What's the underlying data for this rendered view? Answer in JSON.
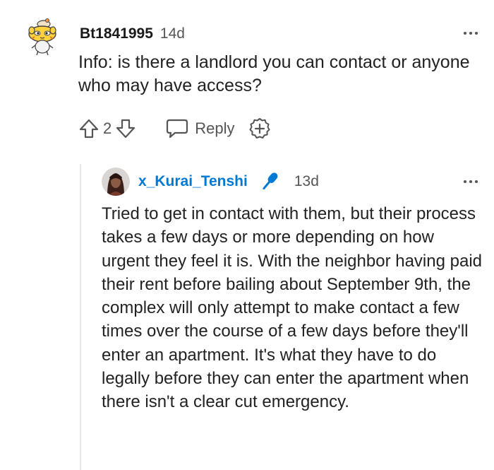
{
  "comment": {
    "username": "Bt1841995",
    "age": "14d",
    "body": "Info: is there a landlord you can contact or anyone who may have access?",
    "vote_count": "2",
    "reply_label": "Reply"
  },
  "reply": {
    "username": "x_Kurai_Tenshi",
    "age": "13d",
    "body": "Tried to get in contact with them, but their process takes a few days or more depending on how urgent they feel it is. With the neighbor having paid their rent before bailing about September 9th, the complex will only attempt to make contact a few times over the course of a few days before they'll enter an apartment. It's what they have to do legally before they can enter the apartment when there isn't a clear cut emergency."
  },
  "icons": {
    "upvote": "upvote-arrow-icon",
    "downvote": "downvote-arrow-icon",
    "reply": "speech-bubble-icon",
    "award": "award-plus-icon",
    "more": "more-options-icon",
    "mic": "microphone-icon"
  },
  "colors": {
    "reply_username": "#0079d3",
    "text": "#222222",
    "muted": "#555555"
  }
}
